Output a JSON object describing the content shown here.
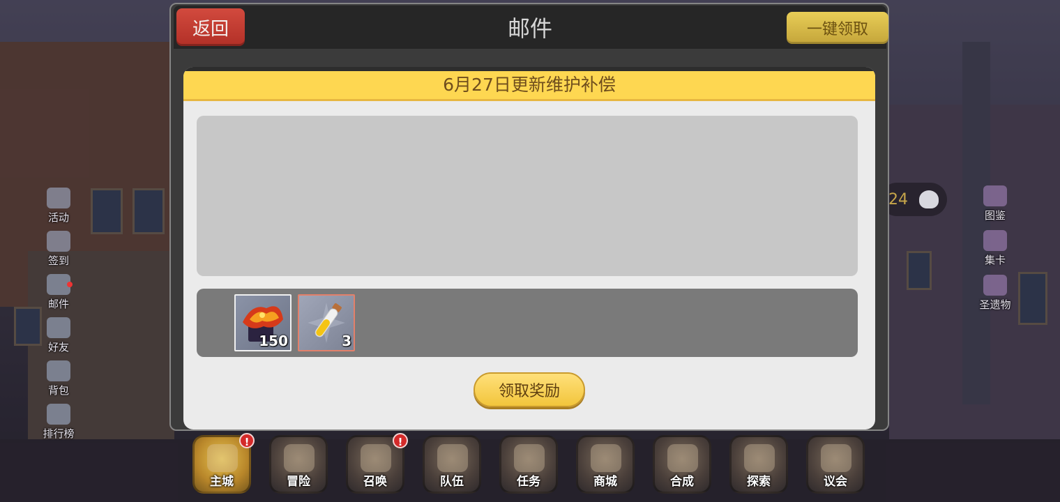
{
  "dialog": {
    "back_label": "返回",
    "title": "邮件",
    "claim_all_label": "一键领取"
  },
  "mail": {
    "subject": "6月27日更新维护补偿",
    "body": "",
    "rewards": [
      {
        "name": "treasure-chest",
        "quantity": "150",
        "border_color": "#f0f0f0"
      },
      {
        "name": "potion-vial",
        "quantity": "3",
        "border_color": "#e3806a"
      }
    ],
    "claim_label": "领取奖励"
  },
  "left_menu": [
    {
      "label": "活动",
      "icon": "megaphone-icon"
    },
    {
      "label": "签到",
      "icon": "checklist-icon"
    },
    {
      "label": "邮件",
      "icon": "envelope-icon",
      "dot": true
    },
    {
      "label": "好友",
      "icon": "friends-icon"
    },
    {
      "label": "背包",
      "icon": "backpack-icon"
    },
    {
      "label": "排行榜",
      "icon": "ranking-icon"
    }
  ],
  "right_menu": [
    {
      "label": "图鉴",
      "icon": "book-icon"
    },
    {
      "label": "集卡",
      "icon": "card-icon"
    },
    {
      "label": "圣遗物",
      "icon": "relic-icon"
    }
  ],
  "resource_pill": {
    "value": "24",
    "icon": "ghost-icon"
  },
  "bottom_nav": [
    {
      "label": "主城",
      "icon": "castle-icon",
      "active": true,
      "alert": "!"
    },
    {
      "label": "冒险",
      "icon": "crossed-weapons-icon"
    },
    {
      "label": "召唤",
      "icon": "summon-card-icon",
      "alert": "!"
    },
    {
      "label": "队伍",
      "icon": "winged-emblem-icon"
    },
    {
      "label": "任务",
      "icon": "quest-book-icon"
    },
    {
      "label": "商城",
      "icon": "shop-icon"
    },
    {
      "label": "合成",
      "icon": "flask-icon"
    },
    {
      "label": "探索",
      "icon": "compass-icon"
    },
    {
      "label": "议会",
      "icon": "council-icon"
    }
  ],
  "colors": {
    "subject_bar": "#fed751",
    "back_button": "#c43a30",
    "claim_button": "#f2c53c"
  }
}
